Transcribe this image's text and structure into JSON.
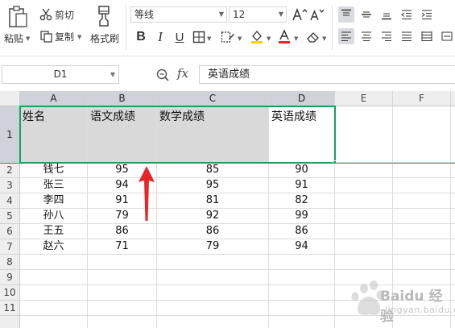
{
  "ribbon": {
    "paste_label": "粘贴",
    "cut_label": "剪切",
    "copy_label": "复制",
    "format_painter_label": "格式刷",
    "font_name": "等线",
    "font_size": "12"
  },
  "formula_bar": {
    "cell_ref": "D1",
    "fx_label": "fx",
    "content": "英语成绩"
  },
  "sheet": {
    "columns": [
      "A",
      "B",
      "C",
      "D",
      "E",
      "F"
    ],
    "rows": [
      "1",
      "2",
      "3",
      "4",
      "5",
      "6",
      "7",
      "8",
      "9",
      "10",
      "11"
    ],
    "header_cells": [
      "姓名",
      "语文成绩",
      "数学成绩",
      "英语成绩"
    ],
    "data_rows": [
      [
        "钱七",
        "95",
        "85",
        "90"
      ],
      [
        "张三",
        "94",
        "95",
        "91"
      ],
      [
        "李四",
        "91",
        "81",
        "82"
      ],
      [
        "孙八",
        "79",
        "92",
        "99"
      ],
      [
        "王五",
        "86",
        "86",
        "86"
      ],
      [
        "赵六",
        "71",
        "79",
        "94"
      ]
    ]
  },
  "watermark": {
    "text": "Baidu 经验",
    "sub": "jingyan.baidu.com"
  },
  "colors": {
    "selection": "#1f9e5b",
    "arrow": "#e8262a",
    "header_fill": "#d9d9d9"
  }
}
